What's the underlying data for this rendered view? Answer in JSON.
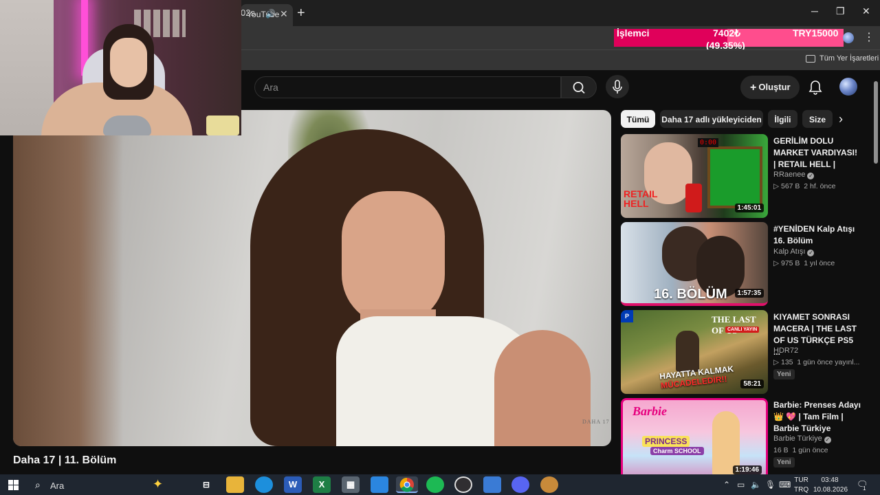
{
  "browser": {
    "tab_title": "- YouTube",
    "new_tab_symbol": "+",
    "window_controls": {
      "minimize": "─",
      "maximize": "❐",
      "close": "✕"
    },
    "url_fragment": "02s",
    "bookmarks_label": "Tüm Yer İşaretleri",
    "extension": {
      "label": "İşlemci",
      "current": "7402₺",
      "percent_text": "(49.35%)",
      "target": "TRY15000",
      "progress_fraction": 0.4935,
      "fill_color": "#e0005a",
      "track_color": "#ff4d8d"
    }
  },
  "youtube": {
    "search_placeholder": "Ara",
    "create_label": "Oluştur",
    "video_title": "Daha 17 | 11. Bölüm",
    "player_watermark": "DAHA 17",
    "chips": [
      "Tümü",
      "Daha 17 adlı yükleyiciden",
      "İlgili",
      "Size"
    ],
    "recommendations": [
      {
        "title": "GERİLİM DOLU MARKET VARDIYASI! | RETAIL HELL |",
        "channel": "RRaenee",
        "views": "567 B",
        "age": "2 hf. önce",
        "duration": "1:45:01",
        "thumb_text": "RETAIL HELL",
        "thumb_digits": "0:00"
      },
      {
        "title": "#YENİDEN Kalp Atışı 16. Bölüm",
        "channel": "Kalp Atışı",
        "views": "975 B",
        "age": "1 yıl önce",
        "duration": "1:57:35",
        "thumb_text": "16. BÖLÜM"
      },
      {
        "title": "KIYAMET SONRASI MACERA | THE LAST OF US TÜRKÇE PS5 ...",
        "channel": "HDR72",
        "views": "135",
        "age": "1 gün önce yayınl...",
        "badge": "Yeni",
        "duration": "58:21",
        "thumb_text": "THE LAST OF US",
        "thumb_live": "CANLI YAYIN",
        "thumb_slogan1": "HAYATTA KALMAK",
        "thumb_slogan2": "MÜCADELEDİR!!"
      },
      {
        "title": "Barbie: Prenses Adayı 👑 💖 | Tam Film | Barbie Türkiye",
        "channel": "Barbie Türkiye",
        "views": "16 B",
        "age": "1 gün önce",
        "badge": "Yeni",
        "duration": "1:19:46",
        "thumb_brand": "Barbie",
        "thumb_princess": "PRINCESS",
        "thumb_school": "Charm SCHOOL"
      }
    ]
  },
  "taskbar": {
    "search_label": "Ara",
    "language": "TUR",
    "language_sub": "TRQ",
    "time": "03:48",
    "date": "10.08.2026",
    "notification_count": "1",
    "apps": [
      "task-view",
      "file-explorer",
      "edge",
      "word",
      "excel",
      "calculator",
      "store",
      "chrome",
      "spotify",
      "obs",
      "app-grid",
      "discord",
      "app-fox"
    ]
  }
}
